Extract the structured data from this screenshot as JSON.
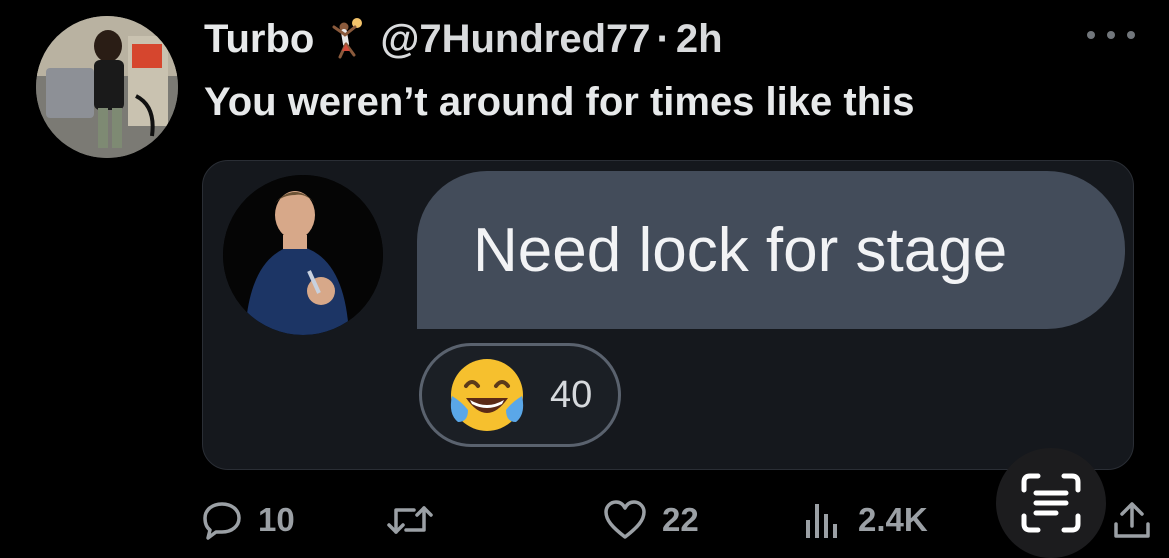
{
  "tweet": {
    "display_name": "Turbo",
    "name_emoji": "person-playing-handball-emoji",
    "handle": "@7Hundred77",
    "separator": "·",
    "time": "2h",
    "text": "You weren’t around for times like this"
  },
  "media": {
    "message_text": "Need lock for stage",
    "reaction_emoji": "face-with-tears-of-joy-emoji",
    "reaction_count": "40"
  },
  "actions": {
    "replies": "10",
    "retweets": "",
    "likes": "22",
    "views": "2.4K"
  },
  "colors": {
    "background": "#000000",
    "text_primary": "#e7e9ea",
    "text_secondary": "#71767b",
    "bubble": "#434c5a",
    "media_bg": "#15181d"
  }
}
